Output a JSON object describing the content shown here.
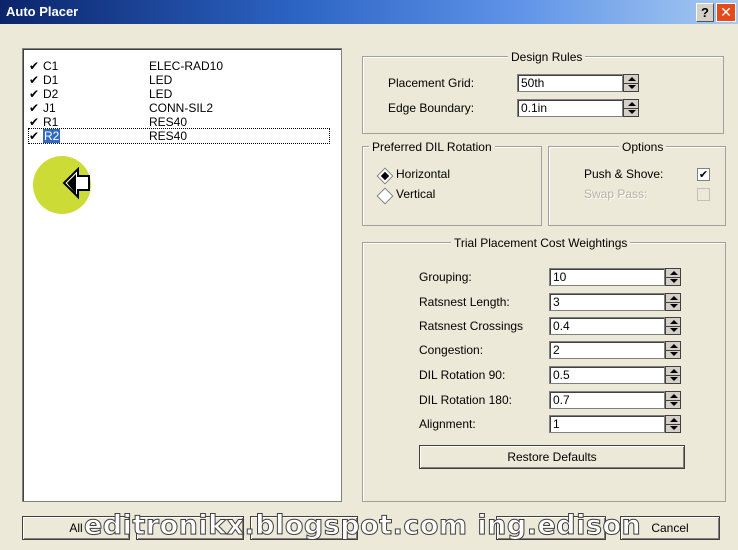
{
  "window": {
    "title": "Auto Placer",
    "help_glyph": "?",
    "close_glyph": "✕"
  },
  "components": [
    {
      "checked": true,
      "designator": "C1",
      "footprint": "ELEC-RAD10"
    },
    {
      "checked": true,
      "designator": "D1",
      "footprint": "LED"
    },
    {
      "checked": true,
      "designator": "D2",
      "footprint": "LED"
    },
    {
      "checked": true,
      "designator": "J1",
      "footprint": "CONN-SIL2"
    },
    {
      "checked": true,
      "designator": "R1",
      "footprint": "RES40"
    },
    {
      "checked": true,
      "designator": "R2",
      "footprint": "RES40",
      "selected": true
    }
  ],
  "check_glyph": "✔",
  "design_rules": {
    "title": "Design Rules",
    "placement_grid_label": "Placement Grid:",
    "placement_grid_value": "50th",
    "edge_boundary_label": "Edge Boundary:",
    "edge_boundary_value": "0.1in"
  },
  "dil_rotation": {
    "title": "Preferred DIL Rotation",
    "horizontal_label": "Horizontal",
    "vertical_label": "Vertical",
    "selected": "Horizontal"
  },
  "options": {
    "title": "Options",
    "push_shove_label": "Push & Shove:",
    "push_shove_checked": true,
    "swap_pass_label": "Swap Pass:",
    "swap_pass_checked": false,
    "swap_pass_enabled": false
  },
  "cost_weightings": {
    "title": "Trial Placement Cost Weightings",
    "rows": [
      {
        "label": "Grouping:",
        "value": "10"
      },
      {
        "label": "Ratsnest Length:",
        "value": "3"
      },
      {
        "label": "Ratsnest Crossings",
        "value": "0.4"
      },
      {
        "label": "Congestion:",
        "value": "2"
      },
      {
        "label": "DIL Rotation 90:",
        "value": "0.5"
      },
      {
        "label": "DIL Rotation 180:",
        "value": "0.7"
      },
      {
        "label": "Alignment:",
        "value": "1"
      }
    ],
    "restore_defaults_label": "Restore Defaults"
  },
  "buttons": {
    "all_label": "All",
    "cancel_label": "Cancel"
  },
  "watermark": "editronikx.blogspot.com ing.edison",
  "colors": {
    "titlebar_start": "#0b246a",
    "titlebar_end": "#a6caf0",
    "dialog_bg": "#ece9d8",
    "selection": "#316ac5",
    "cursor_highlight": "#c9d92a",
    "close_button": "#e34a1c"
  }
}
